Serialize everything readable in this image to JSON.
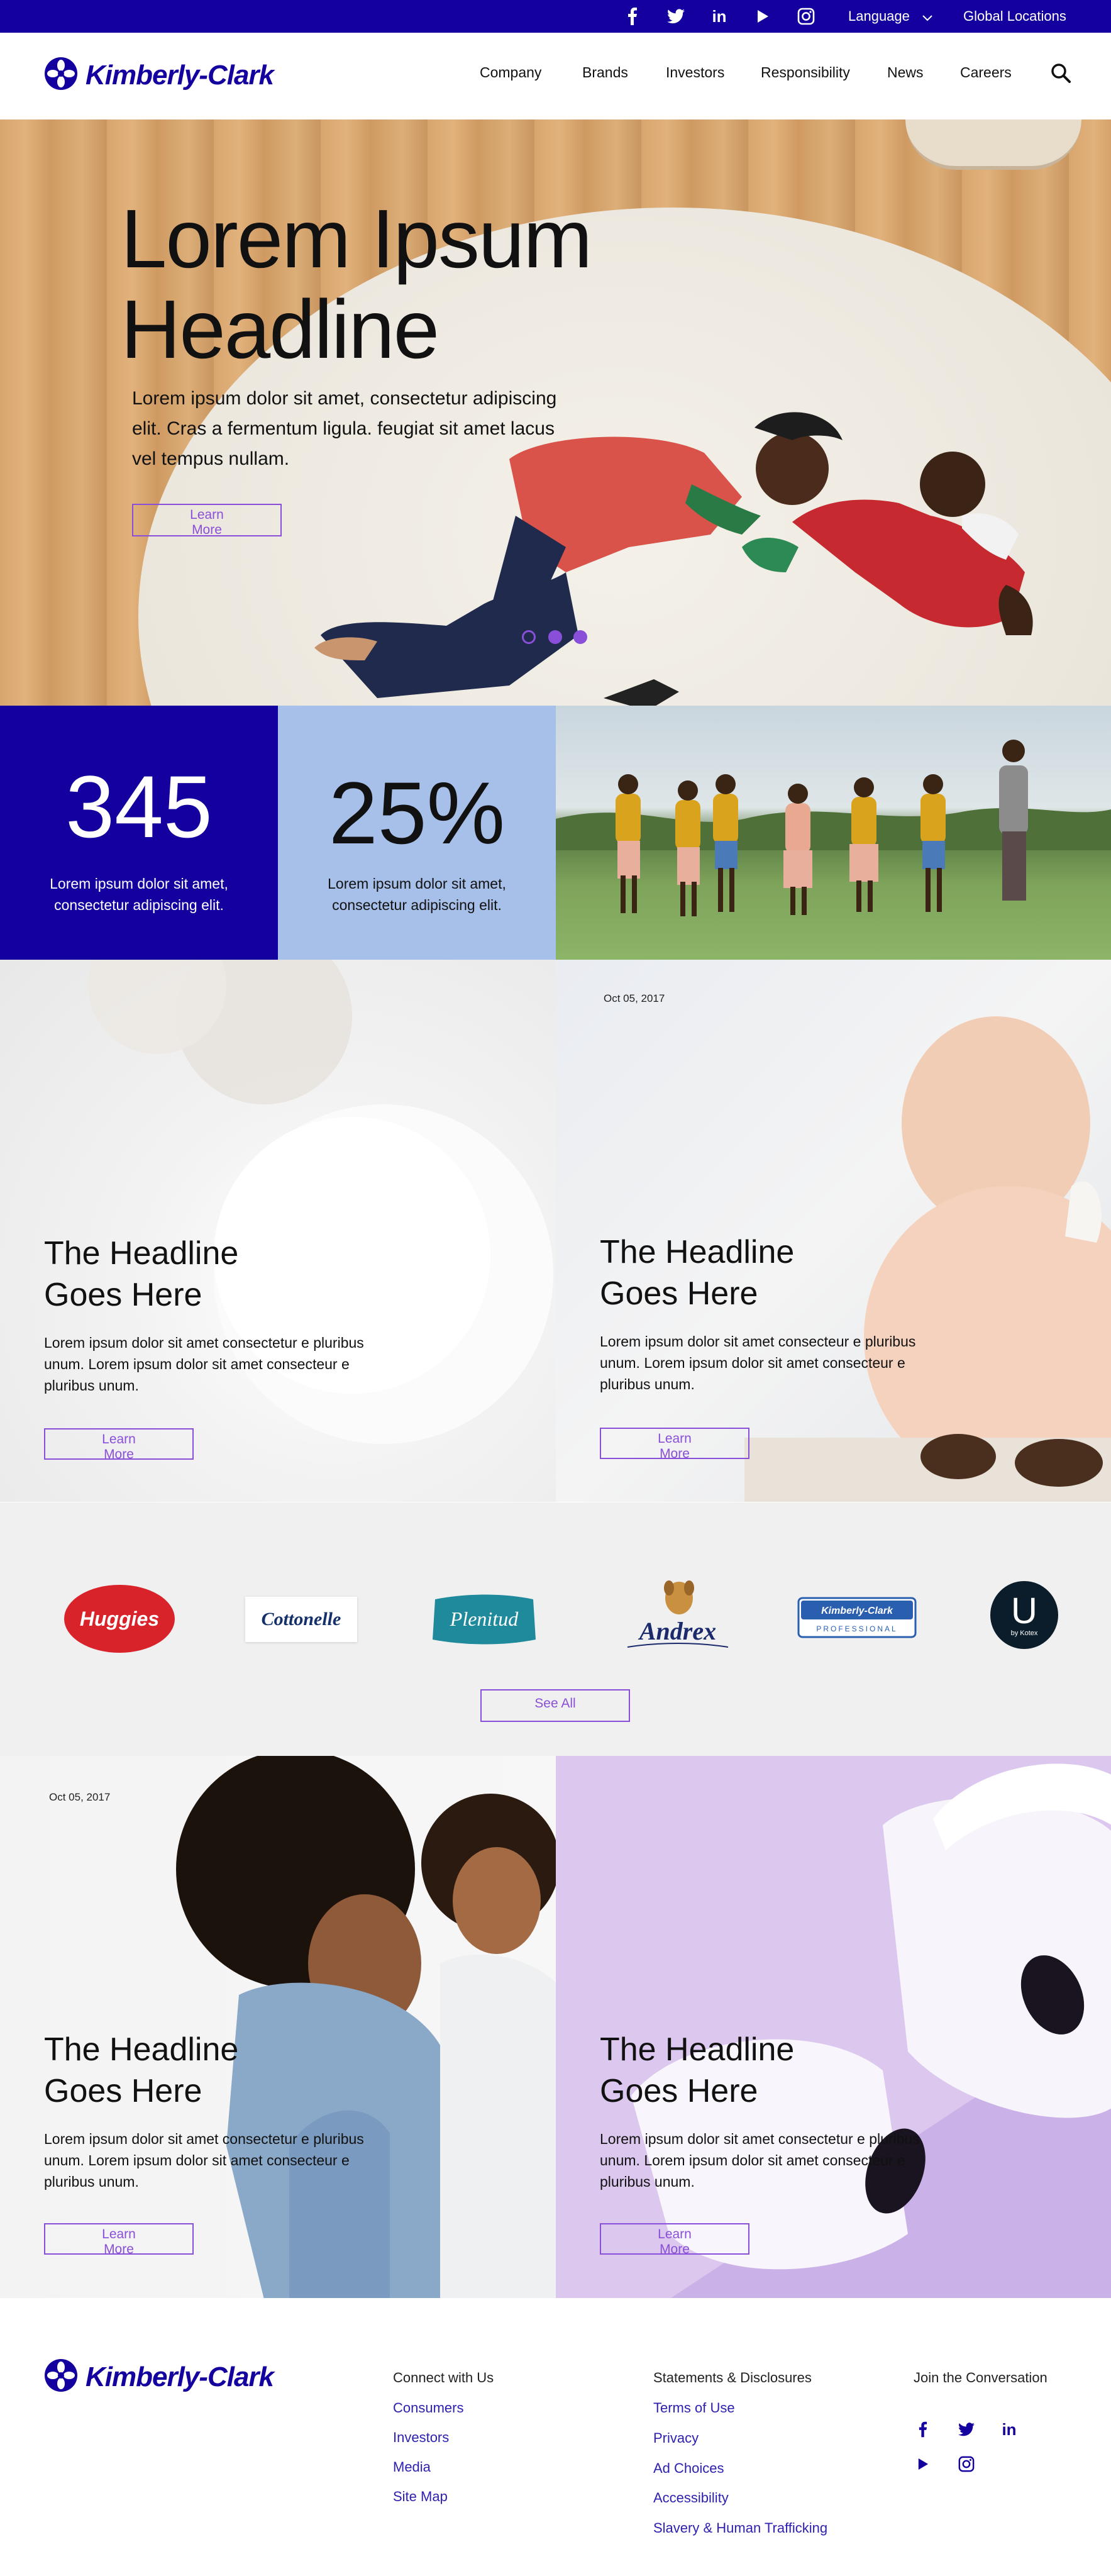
{
  "utility_bar": {
    "social_icons": [
      "facebook-icon",
      "twitter-icon",
      "linkedin-icon",
      "youtube-icon",
      "instagram-icon"
    ],
    "language_label": "Language",
    "global_locations_label": "Global Locations"
  },
  "header": {
    "logo_text": "Kimberly-Clark",
    "nav": [
      "Company",
      "Brands",
      "Investors",
      "Responsibility",
      "News",
      "Careers"
    ]
  },
  "hero": {
    "title_line1": "Lorem Ipsum",
    "title_line2": "Headline",
    "body": "Lorem ipsum dolor sit amet, consectetur adipiscing elit. Cras a fermentum ligula. feugiat sit amet lacus vel tempus nullam.",
    "button_line1": "Learn",
    "button_line2": "More",
    "carousel_active_index": 0,
    "carousel_count": 3
  },
  "stats": [
    {
      "number": "345",
      "text": "Lorem ipsum dolor sit amet, consectetur adipiscing elit."
    },
    {
      "number": "25%",
      "text": "Lorem ipsum dolor sit amet, consectetur adipiscing elit."
    }
  ],
  "cards": [
    {
      "date": "",
      "title_line1": "The Headline",
      "title_line2": "Goes Here",
      "body": "Lorem ipsum dolor sit amet consectetur e pluribus unum. Lorem ipsum dolor sit amet consecteur e pluribus unum.",
      "button_line1": "Learn",
      "button_line2": "More"
    },
    {
      "date": "Oct 05, 2017",
      "title_line1": "The Headline",
      "title_line2": "Goes Here",
      "body": "Lorem ipsum dolor sit amet consecteur e pluribus unum. Lorem ipsum dolor sit amet consecteur e pluribus unum.",
      "button_line1": "Learn",
      "button_line2": "More"
    },
    {
      "date": "Oct 05, 2017",
      "title_line1": "The Headline",
      "title_line2": "Goes Here",
      "body": "Lorem ipsum dolor sit amet consectetur e pluribus unum. Lorem ipsum dolor sit amet consecteur e pluribus unum.",
      "button_line1": "Learn",
      "button_line2": "More"
    },
    {
      "date": "",
      "title_line1": "The Headline",
      "title_line2": "Goes Here",
      "body": "Lorem ipsum dolor sit amet consectetur e pluribus unum. Lorem ipsum dolor sit amet consecteur e pluribus unum.",
      "button_line1": "Learn",
      "button_line2": "More"
    }
  ],
  "brands": {
    "logos": [
      "Huggies",
      "Cottonelle",
      "Plenitud",
      "Andrex",
      "Kimberly-Clark",
      "PROFESSIONAL",
      "U",
      "by Kotex"
    ],
    "see_all_label": "See All"
  },
  "footer": {
    "logo_text": "Kimberly-Clark",
    "col1_heading": "Connect with Us",
    "col1_links": [
      "Consumers",
      "Investors",
      "Media",
      "Site Map"
    ],
    "col2_heading": "Statements & Disclosures",
    "col2_links": [
      "Terms of Use",
      "Privacy",
      "Ad Choices",
      "Accessibility",
      "Slavery & Human Trafficking"
    ],
    "col3_heading": "Join the Conversation",
    "social_icons": [
      "facebook-icon",
      "twitter-icon",
      "linkedin-icon",
      "youtube-icon",
      "instagram-icon"
    ]
  },
  "colors": {
    "brand_navy": "#14009e",
    "stat_light": "#a7c0ea",
    "accent_purple": "#8a4fd8",
    "link_blue": "#2d1fb0",
    "brands_bg": "#f0f0f0"
  }
}
